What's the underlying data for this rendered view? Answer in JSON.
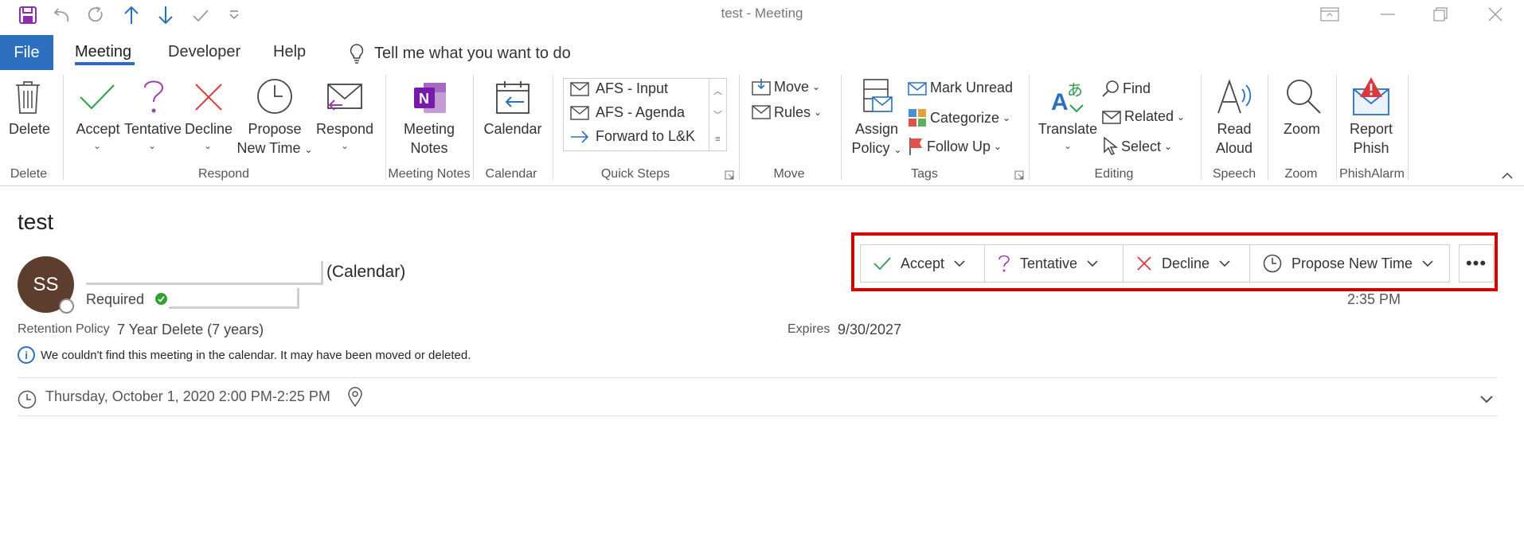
{
  "window": {
    "title": "test  -  Meeting"
  },
  "qat": {
    "icons": [
      "save-icon",
      "undo-icon",
      "redo-icon",
      "up-arrow-icon",
      "down-arrow-icon",
      "checkmark-icon",
      "customize-icon"
    ]
  },
  "tabs": {
    "file": "File",
    "items": [
      {
        "label": "Meeting",
        "active": true
      },
      {
        "label": "Developer"
      },
      {
        "label": "Help"
      }
    ],
    "tellme": "Tell me what you want to do"
  },
  "ribbon": {
    "delete": {
      "label": "Delete",
      "group": "Delete"
    },
    "respond": {
      "group": "Respond",
      "accept": "Accept",
      "tentative": "Tentative",
      "decline": "Decline",
      "propose_line1": "Propose",
      "propose_line2": "New Time",
      "respond": "Respond"
    },
    "meeting_notes": {
      "line1": "Meeting",
      "line2": "Notes",
      "group": "Meeting Notes"
    },
    "calendar": {
      "label": "Calendar",
      "group": "Calendar"
    },
    "quick_steps": {
      "group": "Quick Steps",
      "items": [
        "AFS - Input",
        "AFS - Agenda",
        "Forward to L&K"
      ]
    },
    "move": {
      "group": "Move",
      "move": "Move",
      "rules": "Rules"
    },
    "tags": {
      "group": "Tags",
      "assign_line1": "Assign",
      "assign_line2": "Policy",
      "mark_unread": "Mark Unread",
      "categorize": "Categorize",
      "follow_up": "Follow Up"
    },
    "editing": {
      "group": "Editing",
      "translate": "Translate",
      "find": "Find",
      "related": "Related",
      "select": "Select"
    },
    "speech": {
      "group": "Speech",
      "line1": "Read",
      "line2": "Aloud"
    },
    "zoom": {
      "group": "Zoom",
      "label": "Zoom"
    },
    "phishalarm": {
      "group": "PhishAlarm",
      "line1": "Report",
      "line2": "Phish"
    }
  },
  "message": {
    "subject": "test",
    "avatar_initials": "SS",
    "calendar_tag": "(Calendar)",
    "required_label": "Required",
    "response_bar": {
      "accept": "Accept",
      "tentative": "Tentative",
      "decline": "Decline",
      "propose": "Propose New Time",
      "more": "•••"
    },
    "sent_time": "2:35 PM",
    "retention_label": "Retention Policy",
    "retention_value": "7 Year Delete (7 years)",
    "expires_label": "Expires",
    "expires_value": "9/30/2027",
    "info": "We couldn't find this meeting in the calendar. It may have been moved or deleted.",
    "when": "Thursday, October 1, 2020 2:00 PM-2:25 PM"
  },
  "colors": {
    "accent": "#2b6fbe",
    "accept_green": "#2e9b4f",
    "decline_red": "#d83b3b",
    "tentative_purple": "#9b3fb0",
    "highlight_red": "#d50000"
  }
}
